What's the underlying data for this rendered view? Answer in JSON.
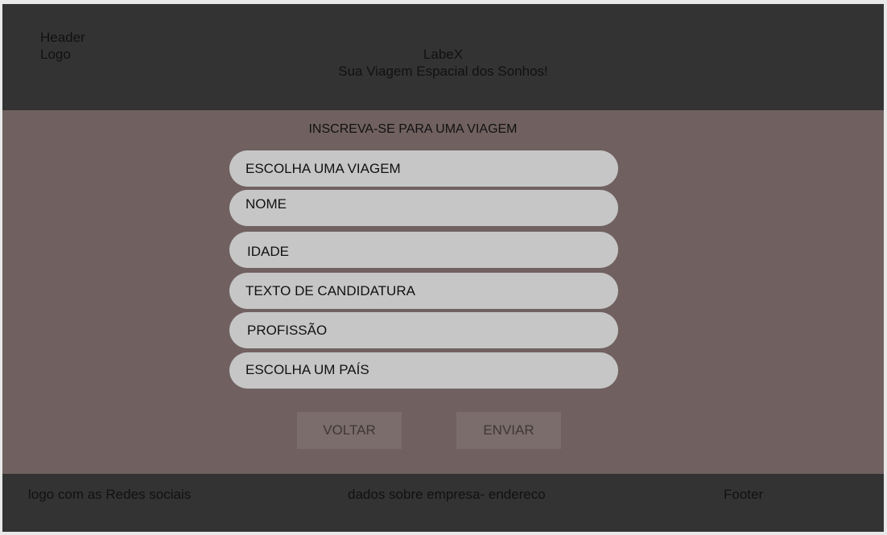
{
  "header": {
    "label": "Header",
    "logo": "Logo",
    "brand": "LabeX",
    "tagline": "Sua Viagem Espacial dos Sonhos!"
  },
  "form": {
    "title": "INSCREVA-SE PARA UMA VIAGEM",
    "fields": [
      "ESCOLHA UMA VIAGEM",
      "NOME",
      "IDADE",
      "TEXTO DE CANDIDATURA",
      "PROFISSÃO",
      "ESCOLHA UM PAÍS"
    ],
    "back_label": "VOLTAR",
    "submit_label": "ENVIAR"
  },
  "footer": {
    "left": "logo com as Redes sociais",
    "center": "dados sobre empresa- endereco",
    "right": "Footer"
  },
  "colors": {
    "header_footer_bg": "#333333",
    "main_bg": "#706160",
    "field_bg": "#c6c6c6",
    "button_bg": "#7b6d6c"
  }
}
